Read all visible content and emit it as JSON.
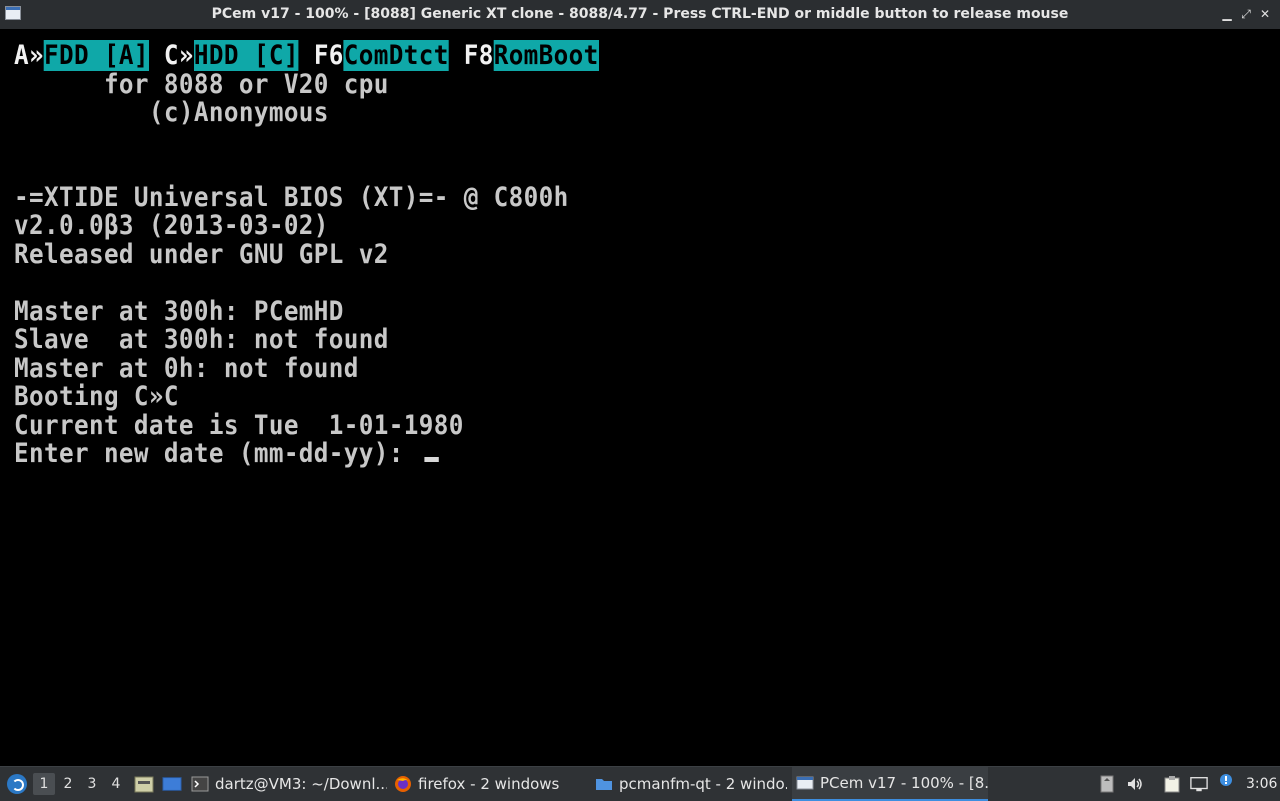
{
  "window": {
    "title": "PCem v17 - 100% - [8088] Generic XT clone - 8088/4.77 - Press CTRL-END or middle button to release mouse",
    "controls": [
      "minimize",
      "maximize",
      "close"
    ]
  },
  "screen": {
    "boot_menu": {
      "a_key": "A»",
      "a_label": "FDD [A]",
      "c_key": "C»",
      "c_label": "HDD [C]",
      "f6_key": "F6",
      "f6_label": "ComDtct",
      "f8_key": "F8",
      "f8_label": "RomBoot"
    },
    "lines": [
      "      for 8088 or V20 cpu",
      "         (c)Anonymous",
      "-=XTIDE Universal BIOS (XT)=- @ C800h",
      "v2.0.0β3 (2013-03-02)",
      "Released under GNU GPL v2",
      "Master at 300h: PCemHD",
      "Slave  at 300h: not found",
      "Master at 0h: not found",
      "Booting C»C",
      "Current date is Tue  1-01-1980",
      "Enter new date (mm-dd-yy): "
    ]
  },
  "taskbar": {
    "desktops": [
      "1",
      "2",
      "3",
      "4"
    ],
    "active_desktop": "1",
    "tasks": [
      {
        "label": "dartz@VM3: ~/Downl...",
        "icon": "terminal-icon"
      },
      {
        "label": "firefox - 2 windows",
        "icon": "firefox-icon"
      },
      {
        "label": "pcmanfm-qt - 2 windo...",
        "icon": "folder-icon"
      },
      {
        "label": "PCem v17 - 100% - [8...",
        "icon": "pcem-icon"
      }
    ],
    "clock": "3:06"
  },
  "colors": {
    "highlight": "#0fa8a8",
    "text": "#c8c8c8",
    "taskbar_bg": "#2f3235",
    "titlebar_bg": "#2b2e31"
  }
}
